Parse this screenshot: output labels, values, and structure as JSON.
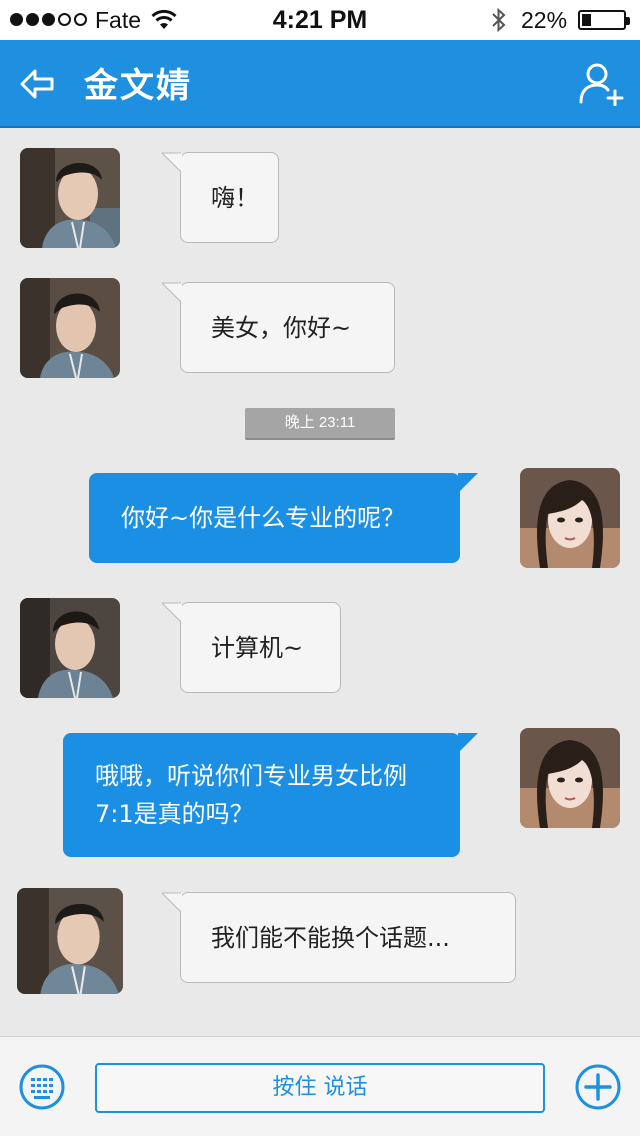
{
  "status_bar": {
    "carrier": "Fate",
    "time": "4:21 PM",
    "battery_percent": "22%",
    "battery_level": 0.22,
    "signal_bars_filled": 3,
    "signal_bars_total": 5,
    "wifi_icon": "wifi-icon",
    "bluetooth_icon": "bluetooth-icon"
  },
  "header": {
    "title": "金文婧",
    "back_icon": "back-arrow-icon",
    "add_icon": "add-contact-icon",
    "background_color": "#1f8fe0"
  },
  "messages": [
    {
      "side": "incoming",
      "text": "嗨！"
    },
    {
      "side": "incoming",
      "text": "美女，你好~"
    },
    {
      "side": "outgoing",
      "text": "你好~你是什么专业的呢？"
    },
    {
      "side": "incoming",
      "text": "计算机~"
    },
    {
      "side": "outgoing",
      "text": "哦哦，听说你们专业男女比例7:1是真的吗？"
    },
    {
      "side": "incoming",
      "text": "我们能不能换个话题..."
    }
  ],
  "timestamp": "晚上 23:11",
  "bottom_bar": {
    "voice_button_label": "按住 说话",
    "keyboard_icon": "keyboard-icon",
    "plus_icon": "plus-circle-icon"
  },
  "colors": {
    "accent": "#1f8fe0",
    "outgoing_bubble": "#1b8fe3",
    "incoming_bubble": "#f5f5f5",
    "chat_background": "#e9e9e9"
  }
}
